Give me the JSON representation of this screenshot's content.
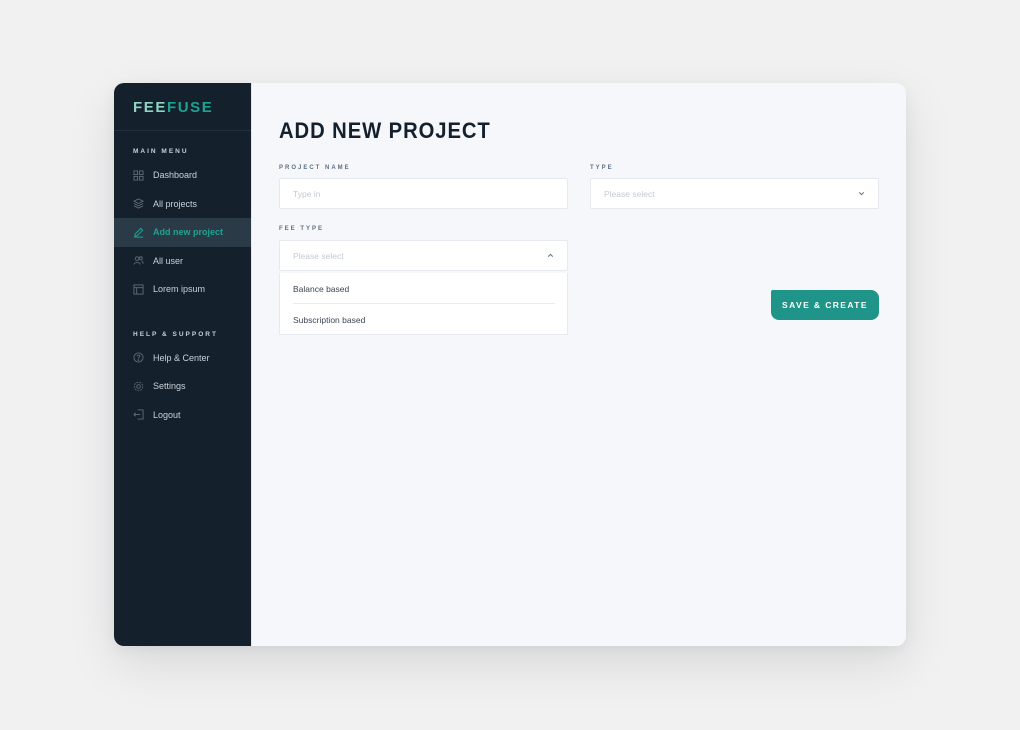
{
  "brand": {
    "part1": "FEE",
    "part2": "FUSE"
  },
  "sidebar": {
    "main_menu_title": "MAIN MENU",
    "main_items": [
      {
        "label": "Dashboard",
        "icon": "grid-icon",
        "active": false
      },
      {
        "label": "All projects",
        "icon": "layers-icon",
        "active": false
      },
      {
        "label": "Add new project",
        "icon": "pencil-icon",
        "active": true
      },
      {
        "label": "All user",
        "icon": "users-icon",
        "active": false
      },
      {
        "label": "Lorem ipsum",
        "icon": "layout-icon",
        "active": false
      }
    ],
    "support_title": "HELP & SUPPORT",
    "support_items": [
      {
        "label": "Help & Center",
        "icon": "help-icon"
      },
      {
        "label": "Settings",
        "icon": "gear-icon"
      },
      {
        "label": "Logout",
        "icon": "logout-icon"
      }
    ]
  },
  "page": {
    "title": "ADD NEW PROJECT",
    "project_name": {
      "label": "PROJECT NAME",
      "placeholder": "Type in",
      "value": ""
    },
    "type": {
      "label": "TYPE",
      "placeholder": "Please select"
    },
    "fee_type": {
      "label": "FEE TYPE",
      "placeholder": "Please select",
      "options": [
        "Balance based",
        "Subscription based"
      ],
      "open": true
    },
    "save_label": "SAVE & CREATE"
  },
  "colors": {
    "sidebar_bg": "#14212d",
    "accent": "#1ea393",
    "button": "#1f9488",
    "content_bg": "#f5f7fb"
  }
}
